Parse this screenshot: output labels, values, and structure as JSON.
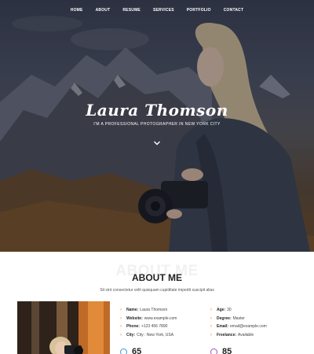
{
  "nav": {
    "items": [
      {
        "label": "HOME"
      },
      {
        "label": "ABOUT"
      },
      {
        "label": "RESUME"
      },
      {
        "label": "SERVICES"
      },
      {
        "label": "PORTFOLIO"
      },
      {
        "label": "CONTACT"
      }
    ]
  },
  "hero": {
    "name": "Laura Thomson",
    "tagline": "I'm a professional photographer in New York City",
    "scroll_icon": "chevron-down-icon"
  },
  "about": {
    "bg_title": "ABOUT ME",
    "title": "ABOUT ME",
    "subtitle": "Sit sint consectetur velit quisquam cupiditate impedit suscipit alias",
    "left": [
      {
        "label": "Name:",
        "value": "Laura Thomson"
      },
      {
        "label": "Website:",
        "value": "www.example.com"
      },
      {
        "label": "Phone:",
        "value": "+123 456 7890"
      },
      {
        "label": "City:",
        "value": "City : New York, USA"
      }
    ],
    "right": [
      {
        "label": "Age:",
        "value": "30"
      },
      {
        "label": "Degree:",
        "value": "Master"
      },
      {
        "label": "Email:",
        "value": "email@example.com"
      },
      {
        "label": "Freelance:",
        "value": "Available"
      }
    ],
    "counters": [
      {
        "value": "65",
        "color": "#3a9ad9"
      },
      {
        "value": "85",
        "color": "#9b59b6"
      }
    ]
  },
  "colors": {
    "accent": "#f5a31a",
    "heading": "#222222"
  }
}
